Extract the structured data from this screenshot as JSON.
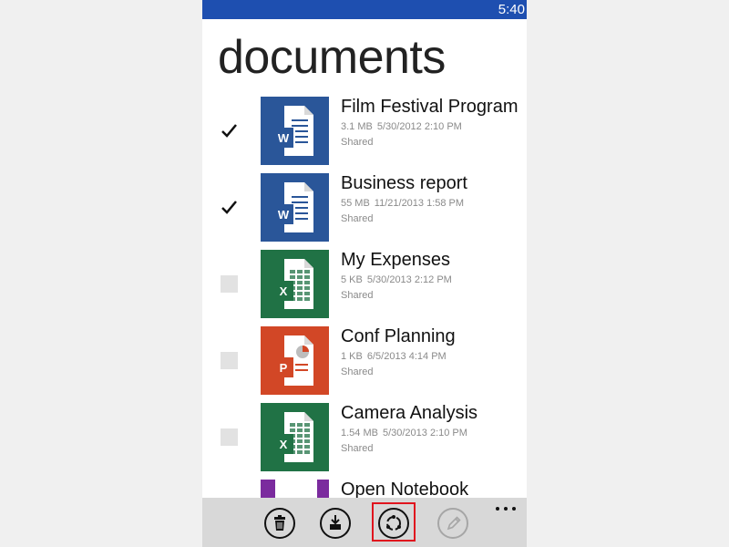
{
  "status_bar": {
    "time": "5:40",
    "color": "#1e4fb0"
  },
  "page": {
    "title": "documents"
  },
  "documents": [
    {
      "name": "Film Festival Program",
      "size": "3.1 MB",
      "date": "5/30/2012 2:10 PM",
      "status": "Shared",
      "type": "word",
      "icon": "word-doc-icon",
      "checked": true,
      "color": "#2a5699"
    },
    {
      "name": "Business report",
      "size": "55 MB",
      "date": "11/21/2013 1:58 PM",
      "status": "Shared",
      "type": "word",
      "icon": "word-doc-icon",
      "checked": true,
      "color": "#2a5699"
    },
    {
      "name": "My Expenses",
      "size": "5 KB",
      "date": "5/30/2013 2:12 PM",
      "status": "Shared",
      "type": "excel",
      "icon": "excel-sheet-icon",
      "checked": false,
      "color": "#207245"
    },
    {
      "name": "Conf Planning",
      "size": "1 KB",
      "date": "6/5/2013 4:14 PM",
      "status": "Shared",
      "type": "powerpoint",
      "icon": "powerpoint-slide-icon",
      "checked": false,
      "color": "#d24726"
    },
    {
      "name": "Camera Analysis",
      "size": "1.54 MB",
      "date": "5/30/2013 2:10 PM",
      "status": "Shared",
      "type": "excel",
      "icon": "excel-sheet-icon",
      "checked": false,
      "color": "#207245"
    },
    {
      "name": "Open Notebook",
      "size": "",
      "date": "",
      "status": "",
      "type": "onenote",
      "icon": "onenote-icon",
      "checked": false,
      "color": "#7b2b9e"
    }
  ],
  "app_bar": {
    "buttons": [
      {
        "name": "delete",
        "icon": "trash-icon",
        "enabled": true
      },
      {
        "name": "save",
        "icon": "download-icon",
        "enabled": true
      },
      {
        "name": "share",
        "icon": "share-icon",
        "enabled": true,
        "highlighted": true
      },
      {
        "name": "edit",
        "icon": "pencil-icon",
        "enabled": false
      }
    ],
    "more": "more-options-icon"
  },
  "highlight_color": "#e0141e"
}
